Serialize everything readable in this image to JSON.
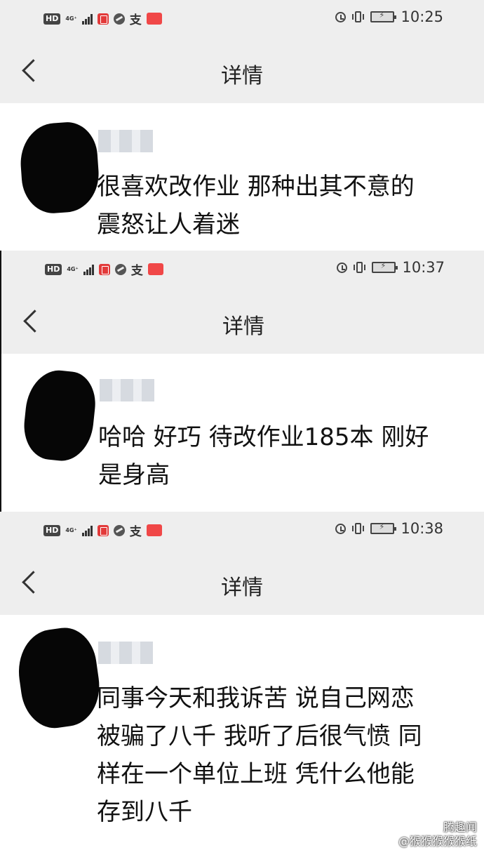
{
  "screens": [
    {
      "status": {
        "net": "4G⁺",
        "zhi": "支",
        "time": "10:25"
      },
      "nav": {
        "title": "详情"
      },
      "message": "很喜欢改作业 那种出其不意的\n震怒让人着迷"
    },
    {
      "status": {
        "net": "4G⁺",
        "zhi": "支",
        "time": "10:37"
      },
      "nav": {
        "title": "详情"
      },
      "message": "哈哈 好巧 待改作业185本  刚好\n是身高"
    },
    {
      "status": {
        "net": "4G⁺",
        "zhi": "支",
        "time": "10:38"
      },
      "nav": {
        "title": "详情"
      },
      "message": "同事今天和我诉苦 说自己网恋\n被骗了八千 我听了后很气愤 同\n样在一个单位上班 凭什么他能\n存到八千"
    }
  ],
  "watermark": {
    "line1": "腾趣闻",
    "line2": "@猴猴猴猴猴纸"
  },
  "icons": {
    "status_left": [
      "hd-icon",
      "signal-icon",
      "book-icon",
      "globe-icon",
      "alipay-icon",
      "app-icon"
    ],
    "status_right": [
      "alarm-icon",
      "vibrate-icon",
      "battery-icon"
    ],
    "nav": [
      "chevron-left-icon"
    ]
  },
  "colors": {
    "bar_bg": "#eeeeee",
    "text": "#111111",
    "badge_red": "#f04747"
  }
}
